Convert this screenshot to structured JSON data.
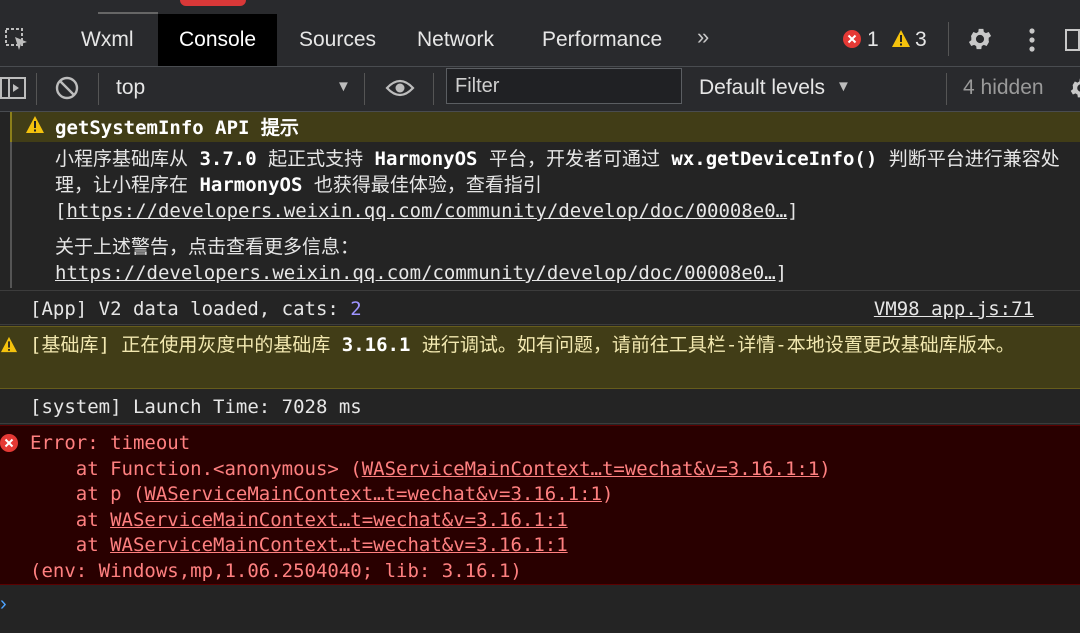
{
  "tabs": [
    {
      "label": "Wxml"
    },
    {
      "label": "Console",
      "active": true
    },
    {
      "label": "Sources"
    },
    {
      "label": "Network"
    },
    {
      "label": "Performance"
    }
  ],
  "more_tabs": "»",
  "badges": {
    "errors": "1",
    "warnings": "3"
  },
  "toolbar": {
    "context": "top",
    "filter_placeholder": "Filter",
    "levels": "Default levels",
    "hidden": "4 hidden"
  },
  "messages": {
    "group": {
      "title": "getSystemInfo API 提示",
      "p1_prefix": "小程序基础库从 ",
      "p1_version": "3.7.0",
      "p1_mid1": " 起正式支持 ",
      "p1_os": "HarmonyOS",
      "p1_mid2": " 平台，开发者可通过 ",
      "p1_api": "wx.getDeviceInfo()",
      "p1_mid3": " 判断平台进行兼容处理，让小程序在 ",
      "p1_os2": "HarmonyOS",
      "p1_mid4": " 也获得最佳体验，查看指引[",
      "p1_link": "https://developers.weixin.qq.com/community/develop/doc/00008e0…",
      "p1_suffix": "]",
      "p2_prefix": "关于上述警告，点击查看更多信息：",
      "p2_link": "https://developers.weixin.qq.com/community/develop/doc/00008e0…",
      "p2_suffix": "]"
    },
    "cats": {
      "text": "[App] V2 data loaded, cats: ",
      "value": "2",
      "source": "VM98 app.js:71"
    },
    "lib_warning": {
      "prefix": "[基础库] 正在使用灰度中的基础库 ",
      "version": "3.16.1",
      "suffix": " 进行调试。如有问题，请前往工具栏-详情-本地设置更改基础库版本。"
    },
    "system": "[system] Launch Time: 7028 ms",
    "error": {
      "title": "Error: timeout",
      "line1_prefix": "    at Function.<anonymous> (",
      "line1_link": "WAServiceMainContext…t=wechat&v=3.16.1:1",
      "line1_suffix": ")",
      "line2_prefix": "    at p (",
      "line2_link": "WAServiceMainContext…t=wechat&v=3.16.1:1",
      "line2_suffix": ")",
      "line3_prefix": "    at ",
      "line3_link": "WAServiceMainContext…t=wechat&v=3.16.1:1",
      "line4_prefix": "    at ",
      "line4_link": "WAServiceMainContext…t=wechat&v=3.16.1:1",
      "env": "(env: Windows,mp,1.06.2504040; lib: 3.16.1)"
    }
  },
  "prompt": "›",
  "colors": {
    "error": "#ff8080",
    "warning_bg": "#413d17",
    "error_bg": "#290000",
    "accent": "#4da3ff"
  }
}
